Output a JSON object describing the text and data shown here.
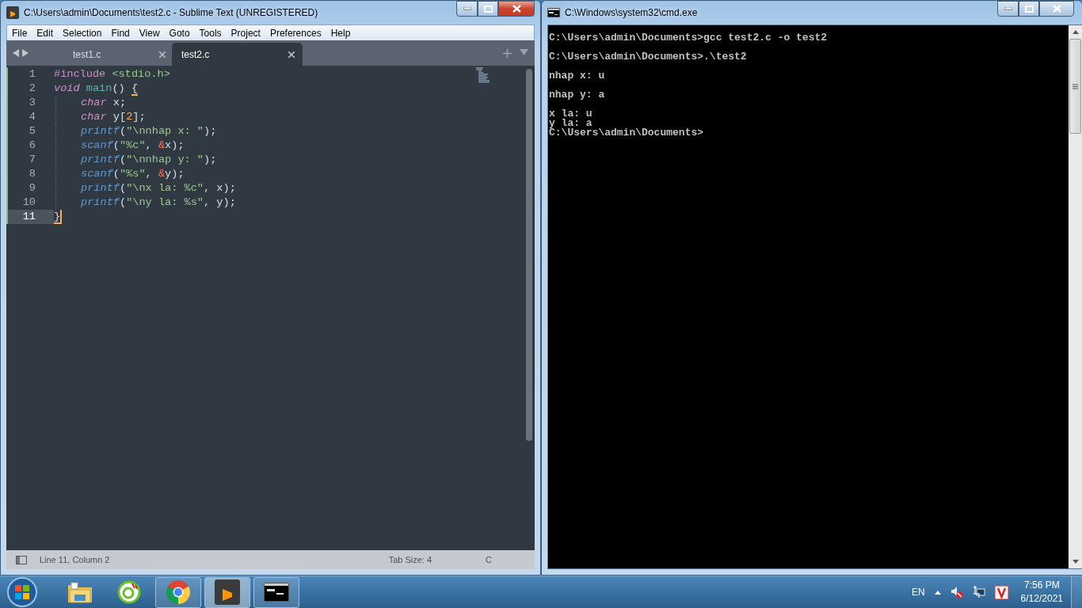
{
  "editor_window": {
    "title": "C:\\Users\\admin\\Documents\\test2.c - Sublime Text (UNREGISTERED)",
    "menu": [
      "File",
      "Edit",
      "Selection",
      "Find",
      "View",
      "Goto",
      "Tools",
      "Project",
      "Preferences",
      "Help"
    ],
    "tabs": [
      {
        "label": "test1.c",
        "selected": false
      },
      {
        "label": "test2.c",
        "selected": true
      }
    ],
    "lines": [
      {
        "number": "1",
        "current": false,
        "indented": false,
        "tokens": [
          {
            "text": "#include ",
            "kind": "preproc"
          },
          {
            "text": "<stdio.h>",
            "kind": "string"
          }
        ]
      },
      {
        "number": "2",
        "current": false,
        "indented": false,
        "tokens": [
          {
            "text": "void ",
            "kind": "storage"
          },
          {
            "text": "main",
            "kind": "entity"
          },
          {
            "text": "() ",
            "kind": "punct"
          },
          {
            "text": "{",
            "kind": "match"
          }
        ]
      },
      {
        "number": "3",
        "current": false,
        "indented": true,
        "tokens": [
          {
            "text": "char ",
            "kind": "storage"
          },
          {
            "text": "x;",
            "kind": "punct"
          }
        ]
      },
      {
        "number": "4",
        "current": false,
        "indented": true,
        "tokens": [
          {
            "text": "char ",
            "kind": "storage"
          },
          {
            "text": "y[",
            "kind": "punct"
          },
          {
            "text": "2",
            "kind": "number"
          },
          {
            "text": "];",
            "kind": "punct"
          }
        ]
      },
      {
        "number": "5",
        "current": false,
        "indented": true,
        "tokens": [
          {
            "text": "printf",
            "kind": "support"
          },
          {
            "text": "(",
            "kind": "punct"
          },
          {
            "text": "\"\\nnhap x: \"",
            "kind": "string"
          },
          {
            "text": ");",
            "kind": "punct"
          }
        ]
      },
      {
        "number": "6",
        "current": false,
        "indented": true,
        "tokens": [
          {
            "text": "scanf",
            "kind": "support"
          },
          {
            "text": "(",
            "kind": "punct"
          },
          {
            "text": "\"%c\"",
            "kind": "string"
          },
          {
            "text": ", ",
            "kind": "punct"
          },
          {
            "text": "&",
            "kind": "operator"
          },
          {
            "text": "x);",
            "kind": "punct"
          }
        ]
      },
      {
        "number": "7",
        "current": false,
        "indented": true,
        "tokens": [
          {
            "text": "printf",
            "kind": "support"
          },
          {
            "text": "(",
            "kind": "punct"
          },
          {
            "text": "\"\\nnhap y: \"",
            "kind": "string"
          },
          {
            "text": ");",
            "kind": "punct"
          }
        ]
      },
      {
        "number": "8",
        "current": false,
        "indented": true,
        "tokens": [
          {
            "text": "scanf",
            "kind": "support"
          },
          {
            "text": "(",
            "kind": "punct"
          },
          {
            "text": "\"%s\"",
            "kind": "string"
          },
          {
            "text": ", ",
            "kind": "punct"
          },
          {
            "text": "&",
            "kind": "operator"
          },
          {
            "text": "y);",
            "kind": "punct"
          }
        ]
      },
      {
        "number": "9",
        "current": false,
        "indented": true,
        "tokens": [
          {
            "text": "printf",
            "kind": "support"
          },
          {
            "text": "(",
            "kind": "punct"
          },
          {
            "text": "\"\\nx la: %c\"",
            "kind": "string"
          },
          {
            "text": ", x);",
            "kind": "punct"
          }
        ]
      },
      {
        "number": "10",
        "current": false,
        "indented": true,
        "tokens": [
          {
            "text": "printf",
            "kind": "support"
          },
          {
            "text": "(",
            "kind": "punct"
          },
          {
            "text": "\"\\ny la: %s\"",
            "kind": "string"
          },
          {
            "text": ", y);",
            "kind": "punct"
          }
        ]
      },
      {
        "number": "11",
        "current": true,
        "indented": false,
        "tokens": [
          {
            "text": "}",
            "kind": "match"
          }
        ]
      }
    ],
    "status_bar": {
      "position": "Line 11, Column 2",
      "tab_size": "Tab Size: 4",
      "syntax": "C"
    }
  },
  "terminal_window": {
    "title": "C:\\Windows\\system32\\cmd.exe",
    "blocks": [
      [
        "C:\\Users\\admin\\Documents>gcc test2.c -o test2"
      ],
      [
        "C:\\Users\\admin\\Documents>.\\test2"
      ],
      [
        "nhap x: u"
      ],
      [
        "nhap y: a"
      ],
      [
        "x la: u",
        "y la: a",
        "C:\\Users\\admin\\Documents>"
      ]
    ]
  },
  "taskbar": {
    "apps": [
      {
        "kind": "folder",
        "running": false,
        "active": false
      },
      {
        "kind": "ring",
        "running": false,
        "active": false
      },
      {
        "kind": "browser",
        "running": true,
        "active": false
      },
      {
        "kind": "editor",
        "running": true,
        "active": true
      },
      {
        "kind": "terminal",
        "running": true,
        "active": false
      }
    ],
    "language": "EN",
    "time": "7:56 PM",
    "date": "6/12/2021"
  }
}
